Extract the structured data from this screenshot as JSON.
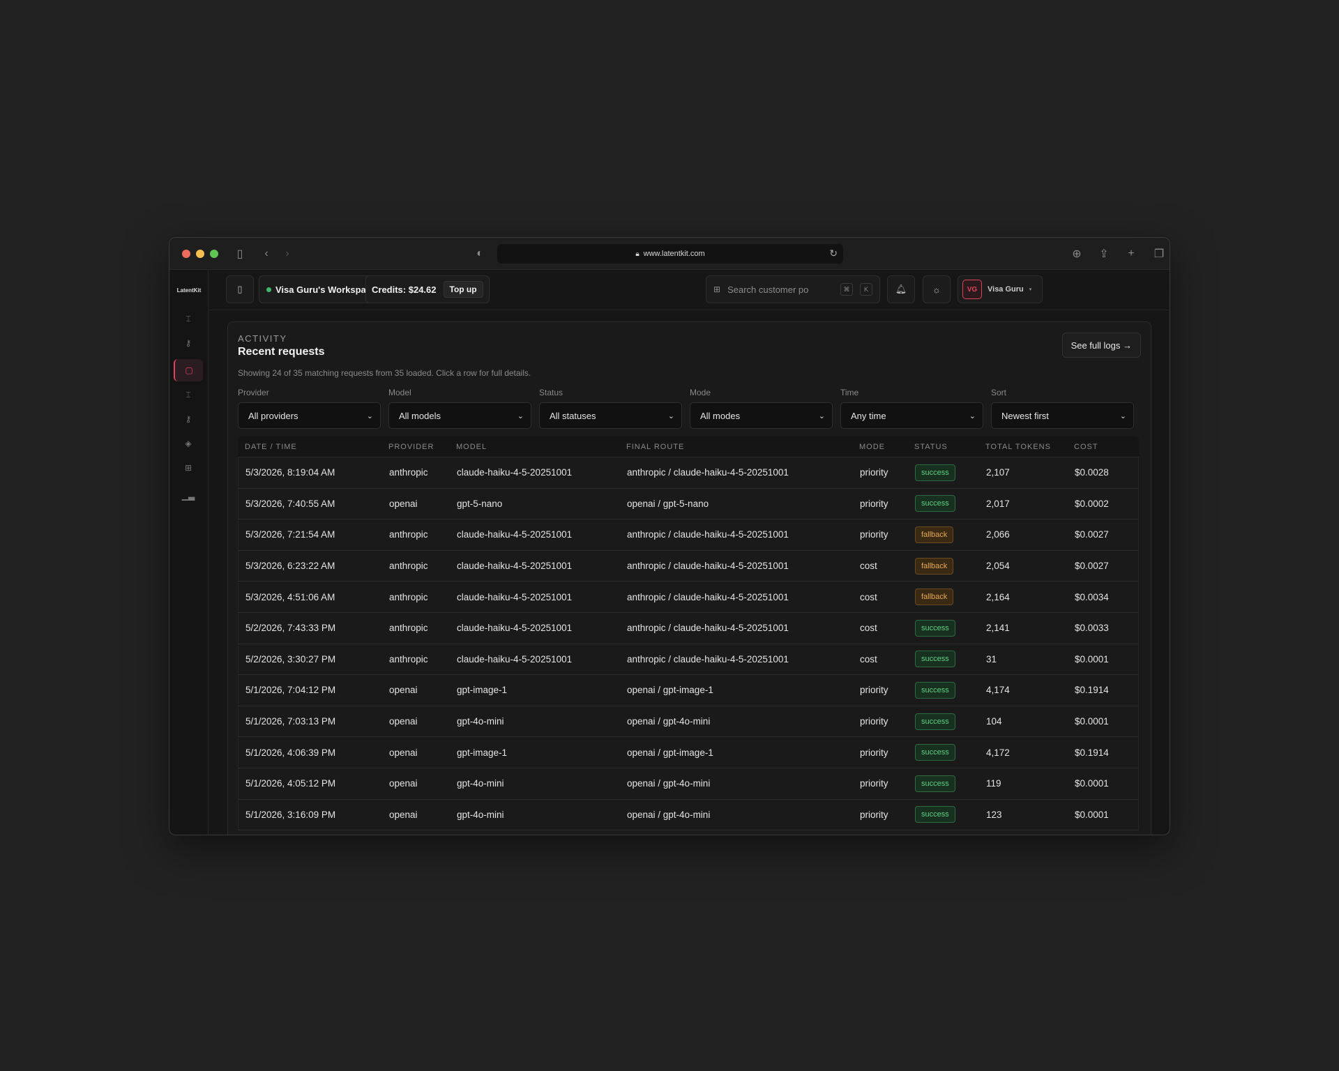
{
  "browser": {
    "url": "www.latentkit.com",
    "traffic_lights": [
      "#ec6a5e",
      "#f4bf4f",
      "#61c554"
    ]
  },
  "app": {
    "brand": "LatentKit",
    "workspace": "Visa Guru's Workspace",
    "credits": "Credits: $24.62",
    "topup": "Top up",
    "search_placeholder": "Search customer po",
    "kbd": [
      "⌘",
      "K"
    ],
    "user_initials": "VG",
    "user_name": "Visa Guru",
    "accent": "#e0445a"
  },
  "panel": {
    "eyebrow": "ACTIVITY",
    "title": "Recent requests",
    "subtitle": "Showing 24 of 35 matching requests from 35 loaded. Click a row for full details.",
    "see_full_logs": "See full logs →"
  },
  "filters": [
    {
      "label": "Provider",
      "value": "All providers"
    },
    {
      "label": "Model",
      "value": "All models"
    },
    {
      "label": "Status",
      "value": "All statuses"
    },
    {
      "label": "Mode",
      "value": "All modes"
    },
    {
      "label": "Time",
      "value": "Any time"
    },
    {
      "label": "Sort",
      "value": "Newest first"
    }
  ],
  "table": {
    "headers": [
      "DATE / TIME",
      "PROVIDER",
      "MODEL",
      "FINAL ROUTE",
      "MODE",
      "STATUS",
      "TOTAL TOKENS",
      "COST"
    ],
    "rows": [
      [
        "5/3/2026, 8:19:04 AM",
        "anthropic",
        "claude-haiku-4-5-20251001",
        "anthropic / claude-haiku-4-5-20251001",
        "priority",
        "success",
        "2,107",
        "$0.0028"
      ],
      [
        "5/3/2026, 7:40:55 AM",
        "openai",
        "gpt-5-nano",
        "openai / gpt-5-nano",
        "priority",
        "success",
        "2,017",
        "$0.0002"
      ],
      [
        "5/3/2026, 7:21:54 AM",
        "anthropic",
        "claude-haiku-4-5-20251001",
        "anthropic / claude-haiku-4-5-20251001",
        "priority",
        "fallback",
        "2,066",
        "$0.0027"
      ],
      [
        "5/3/2026, 6:23:22 AM",
        "anthropic",
        "claude-haiku-4-5-20251001",
        "anthropic / claude-haiku-4-5-20251001",
        "cost",
        "fallback",
        "2,054",
        "$0.0027"
      ],
      [
        "5/3/2026, 4:51:06 AM",
        "anthropic",
        "claude-haiku-4-5-20251001",
        "anthropic / claude-haiku-4-5-20251001",
        "cost",
        "fallback",
        "2,164",
        "$0.0034"
      ],
      [
        "5/2/2026, 7:43:33 PM",
        "anthropic",
        "claude-haiku-4-5-20251001",
        "anthropic / claude-haiku-4-5-20251001",
        "cost",
        "success",
        "2,141",
        "$0.0033"
      ],
      [
        "5/2/2026, 3:30:27 PM",
        "anthropic",
        "claude-haiku-4-5-20251001",
        "anthropic / claude-haiku-4-5-20251001",
        "cost",
        "success",
        "31",
        "$0.0001"
      ],
      [
        "5/1/2026, 7:04:12 PM",
        "openai",
        "gpt-image-1",
        "openai / gpt-image-1",
        "priority",
        "success",
        "4,174",
        "$0.1914"
      ],
      [
        "5/1/2026, 7:03:13 PM",
        "openai",
        "gpt-4o-mini",
        "openai / gpt-4o-mini",
        "priority",
        "success",
        "104",
        "$0.0001"
      ],
      [
        "5/1/2026, 4:06:39 PM",
        "openai",
        "gpt-image-1",
        "openai / gpt-image-1",
        "priority",
        "success",
        "4,172",
        "$0.1914"
      ],
      [
        "5/1/2026, 4:05:12 PM",
        "openai",
        "gpt-4o-mini",
        "openai / gpt-4o-mini",
        "priority",
        "success",
        "119",
        "$0.0001"
      ],
      [
        "5/1/2026, 3:16:09 PM",
        "openai",
        "gpt-4o-mini",
        "openai / gpt-4o-mini",
        "priority",
        "success",
        "123",
        "$0.0001"
      ]
    ]
  }
}
